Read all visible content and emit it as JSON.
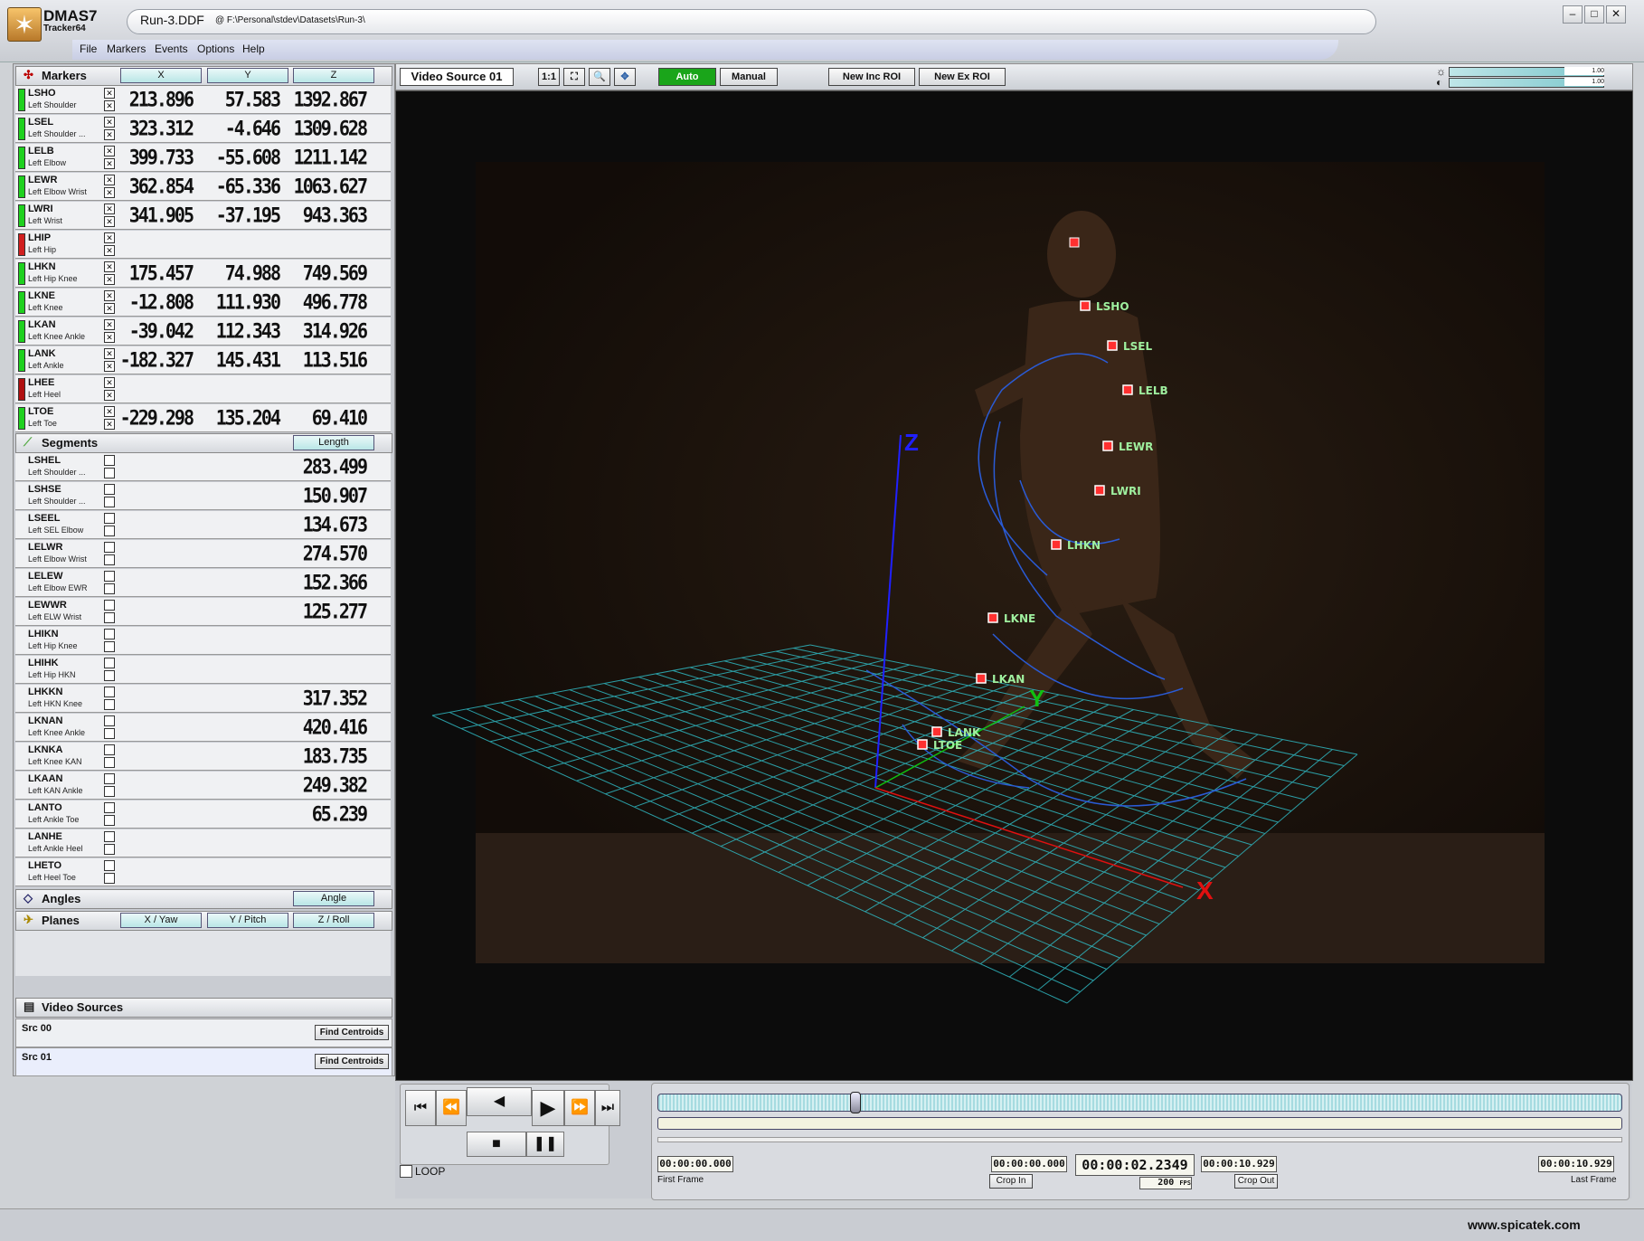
{
  "app": {
    "name": "DMAS7",
    "subtitle": "Tracker64",
    "file_name": "Run-3.DDF",
    "file_path": "@ F:\\Personal\\stdev\\Datasets\\Run-3\\"
  },
  "menu": [
    "File",
    "Markers",
    "Events",
    "Options",
    "Help"
  ],
  "markers": {
    "title": "Markers",
    "columns": [
      "X",
      "Y",
      "Z"
    ],
    "rows": [
      {
        "code": "LSHO",
        "desc": "Left Shoulder",
        "status": "#1fd11f",
        "x": "213.896",
        "y": "57.583",
        "z": "1392.867"
      },
      {
        "code": "LSEL",
        "desc": "Left Shoulder ...",
        "status": "#1fd11f",
        "x": "323.312",
        "y": "-4.646",
        "z": "1309.628"
      },
      {
        "code": "LELB",
        "desc": "Left Elbow",
        "status": "#1fd11f",
        "x": "399.733",
        "y": "-55.608",
        "z": "1211.142"
      },
      {
        "code": "LEWR",
        "desc": "Left Elbow Wrist",
        "status": "#1fd11f",
        "x": "362.854",
        "y": "-65.336",
        "z": "1063.627"
      },
      {
        "code": "LWRI",
        "desc": "Left Wrist",
        "status": "#1fd11f",
        "x": "341.905",
        "y": "-37.195",
        "z": "943.363"
      },
      {
        "code": "LHIP",
        "desc": "Left Hip",
        "status": "#d11f1f",
        "x": "",
        "y": "",
        "z": ""
      },
      {
        "code": "LHKN",
        "desc": "Left Hip Knee",
        "status": "#1fd11f",
        "x": "175.457",
        "y": "74.988",
        "z": "749.569"
      },
      {
        "code": "LKNE",
        "desc": "Left Knee",
        "status": "#1fd11f",
        "x": "-12.808",
        "y": "111.930",
        "z": "496.778"
      },
      {
        "code": "LKAN",
        "desc": "Left Knee Ankle",
        "status": "#1fd11f",
        "x": "-39.042",
        "y": "112.343",
        "z": "314.926"
      },
      {
        "code": "LANK",
        "desc": "Left Ankle",
        "status": "#1fd11f",
        "x": "-182.327",
        "y": "145.431",
        "z": "113.516"
      },
      {
        "code": "LHEE",
        "desc": "Left Heel",
        "status": "#b01010",
        "x": "",
        "y": "",
        "z": ""
      },
      {
        "code": "LTOE",
        "desc": "Left Toe",
        "status": "#1fd11f",
        "x": "-229.298",
        "y": "135.204",
        "z": "69.410"
      }
    ]
  },
  "segments": {
    "title": "Segments",
    "column": "Length",
    "rows": [
      {
        "code": "LSHEL",
        "desc": "Left Shoulder ...",
        "length": "283.499"
      },
      {
        "code": "LSHSE",
        "desc": "Left Shoulder ...",
        "length": "150.907"
      },
      {
        "code": "LSEEL",
        "desc": "Left SEL Elbow",
        "length": "134.673"
      },
      {
        "code": "LELWR",
        "desc": "Left Elbow Wrist",
        "length": "274.570"
      },
      {
        "code": "LELEW",
        "desc": "Left Elbow EWR",
        "length": "152.366"
      },
      {
        "code": "LEWWR",
        "desc": "Left ELW Wrist",
        "length": "125.277"
      },
      {
        "code": "LHIKN",
        "desc": "Left Hip Knee",
        "length": ""
      },
      {
        "code": "LHIHK",
        "desc": "Left Hip HKN",
        "length": ""
      },
      {
        "code": "LHKKN",
        "desc": "Left HKN Knee",
        "length": "317.352"
      },
      {
        "code": "LKNAN",
        "desc": "Left Knee Ankle",
        "length": "420.416"
      },
      {
        "code": "LKNKA",
        "desc": "Left Knee KAN",
        "length": "183.735"
      },
      {
        "code": "LKAAN",
        "desc": "Left KAN Ankle",
        "length": "249.382"
      },
      {
        "code": "LANTO",
        "desc": "Left Ankle Toe",
        "length": "65.239"
      },
      {
        "code": "LANHE",
        "desc": "Left Ankle Heel",
        "length": ""
      },
      {
        "code": "LHETO",
        "desc": "Left Heel Toe",
        "length": ""
      }
    ]
  },
  "angles": {
    "title": "Angles",
    "column": "Angle"
  },
  "planes": {
    "title": "Planes",
    "columns": [
      "X / Yaw",
      "Y / Pitch",
      "Z / Roll"
    ]
  },
  "video_sources": {
    "title": "Video Sources",
    "find_label": "Find Centroids",
    "items": [
      "Src 00",
      "Src 01"
    ]
  },
  "toolbar": {
    "source": "Video Source 01",
    "zoom_1to1": "1:1",
    "auto": "Auto",
    "manual": "Manual",
    "new_inc_roi": "New Inc ROI",
    "new_ex_roi": "New Ex ROI",
    "brightness": "1.00",
    "contrast": "1.00"
  },
  "viewport": {
    "axes": [
      "X",
      "Y",
      "Z"
    ],
    "marker_labels": [
      "LSHO",
      "LSEL",
      "LELB",
      "LEWR",
      "LWRI",
      "LHKN",
      "LKNE",
      "LKAN",
      "LANK",
      "LTOE"
    ]
  },
  "transport": {
    "loop": "LOOP",
    "first_frame": "00:00:00.000",
    "first_frame_label": "First Frame",
    "crop_in_time": "00:00:00.000",
    "crop_in": "Crop In",
    "current": "00:00:02.2349",
    "fps": "200",
    "fps_unit": "FPS",
    "crop_out_time": "00:00:10.929",
    "crop_out": "Crop Out",
    "last_frame": "00:00:10.929",
    "last_frame_label": "Last Frame",
    "progress": 0.2045
  },
  "footer": {
    "website": "www.spicatek.com"
  }
}
